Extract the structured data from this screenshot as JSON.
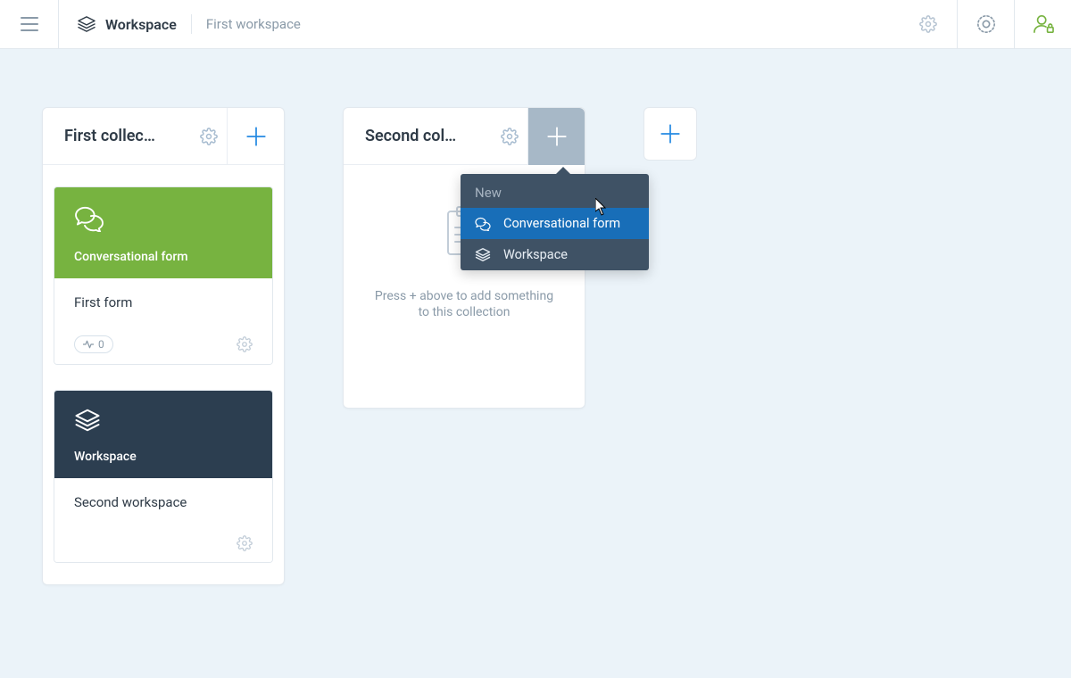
{
  "header": {
    "workspace_label": "Workspace",
    "current_workspace": "First workspace"
  },
  "addCollectionButton": {},
  "popover": {
    "title": "New",
    "item_conversational": "Conversational form",
    "item_workspace": "Workspace"
  },
  "collections": [
    {
      "title": "First collec…",
      "cards": [
        {
          "type": "conversational",
          "type_label": "Conversational form",
          "name": "First form",
          "count": "0"
        },
        {
          "type": "workspace",
          "type_label": "Workspace",
          "name": "Second workspace"
        }
      ]
    },
    {
      "title": "Second col…",
      "empty_text": "Press + above to add something to this collection"
    }
  ]
}
